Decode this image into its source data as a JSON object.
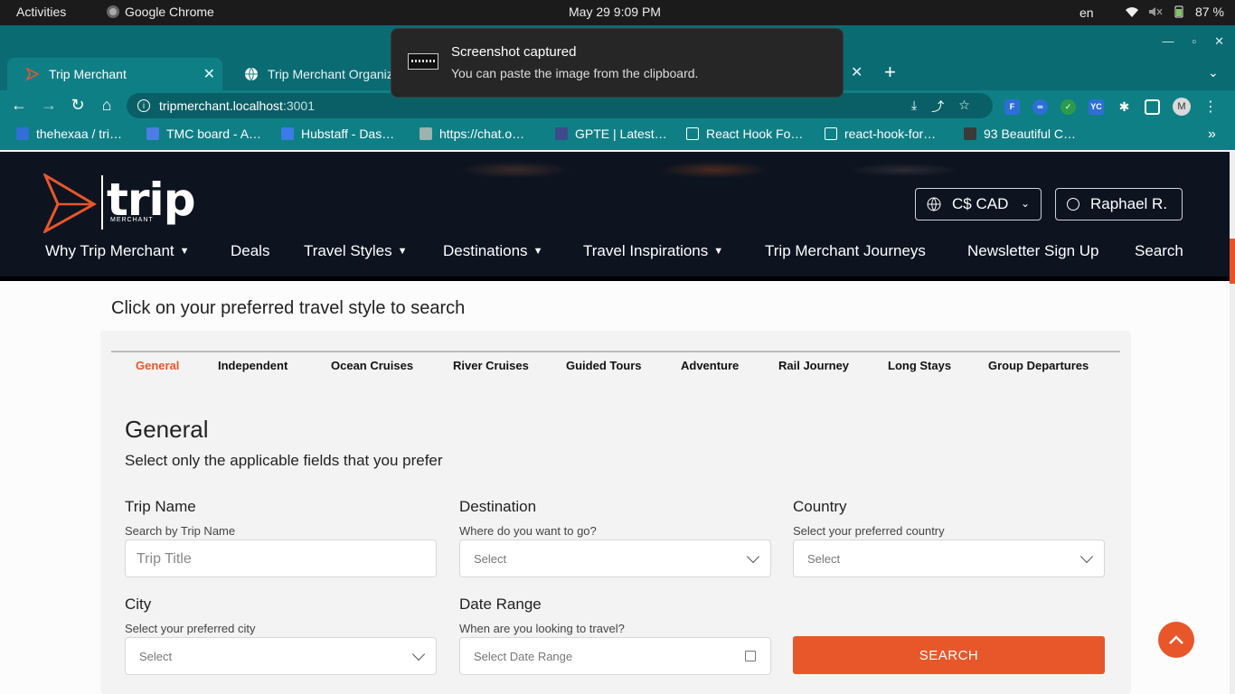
{
  "os": {
    "activities": "Activities",
    "app_name": "Google Chrome",
    "clock": "May 29  9:09 PM",
    "lang": "en",
    "battery": "87 %"
  },
  "notification": {
    "title": "Screenshot captured",
    "body": "You can paste the image from the clipboard."
  },
  "browser": {
    "tabs": [
      {
        "label": "Trip Merchant"
      },
      {
        "label": "Trip Merchant Organiz"
      }
    ],
    "url_host": "tripmerchant.localhost",
    "url_port": ":3001",
    "profile_initial": "M",
    "bookmarks": [
      {
        "label": "thehexaa / tri…",
        "icon": "github-icon",
        "color": "#2f6fd6"
      },
      {
        "label": "TMC board - A…",
        "icon": "jira-icon",
        "color": "#4c7de6"
      },
      {
        "label": "Hubstaff - Das…",
        "icon": "hubstaff-icon",
        "color": "#3b7be8"
      },
      {
        "label": "https://chat.o…",
        "icon": "openai-icon",
        "color": "#9ab5b0"
      },
      {
        "label": "GPTE | Latest…",
        "icon": "gpte-icon",
        "color": "#3e4a8a"
      },
      {
        "label": "React Hook Fo…",
        "icon": "page-icon",
        "color": "transparent"
      },
      {
        "label": "react-hook-for…",
        "icon": "page-icon",
        "color": "transparent"
      },
      {
        "label": "93 Beautiful C…",
        "icon": "dribbble-icon",
        "color": "#3a3a3a"
      }
    ]
  },
  "site": {
    "logo_word": "trip",
    "logo_sub": "MERCHANT",
    "currency": "C$ CAD",
    "user": "Raphael R.",
    "nav": [
      {
        "label": "Why Trip Merchant",
        "caret": true
      },
      {
        "label": "Deals",
        "caret": false
      },
      {
        "label": "Travel Styles",
        "caret": true
      },
      {
        "label": "Destinations",
        "caret": true
      },
      {
        "label": "Travel Inspirations",
        "caret": true
      },
      {
        "label": "Trip Merchant Journeys",
        "caret": false
      },
      {
        "label": "Newsletter Sign Up",
        "caret": false
      },
      {
        "label": "Search",
        "caret": false
      }
    ],
    "accent": "#e8572a"
  },
  "search": {
    "prompt": "Click on your preferred travel style to search",
    "style_tabs": [
      "General",
      "Independent",
      "Ocean Cruises",
      "River Cruises",
      "Guided Tours",
      "Adventure",
      "Rail Journey",
      "Long Stays",
      "Group Departures"
    ],
    "active_tab": "General",
    "heading": "General",
    "subheading": "Select only the applicable fields that you prefer",
    "fields": {
      "trip_name": {
        "label": "Trip Name",
        "hint": "Search by Trip Name",
        "placeholder": "Trip Title"
      },
      "destination": {
        "label": "Destination",
        "hint": "Where do you want to go?",
        "placeholder": "Select"
      },
      "country": {
        "label": "Country",
        "hint": "Select your preferred country",
        "placeholder": "Select"
      },
      "city": {
        "label": "City",
        "hint": "Select your preferred city",
        "placeholder": "Select"
      },
      "date_range": {
        "label": "Date Range",
        "hint": "When are you looking to travel?",
        "placeholder": "Select Date Range"
      }
    },
    "button": "SEARCH"
  }
}
